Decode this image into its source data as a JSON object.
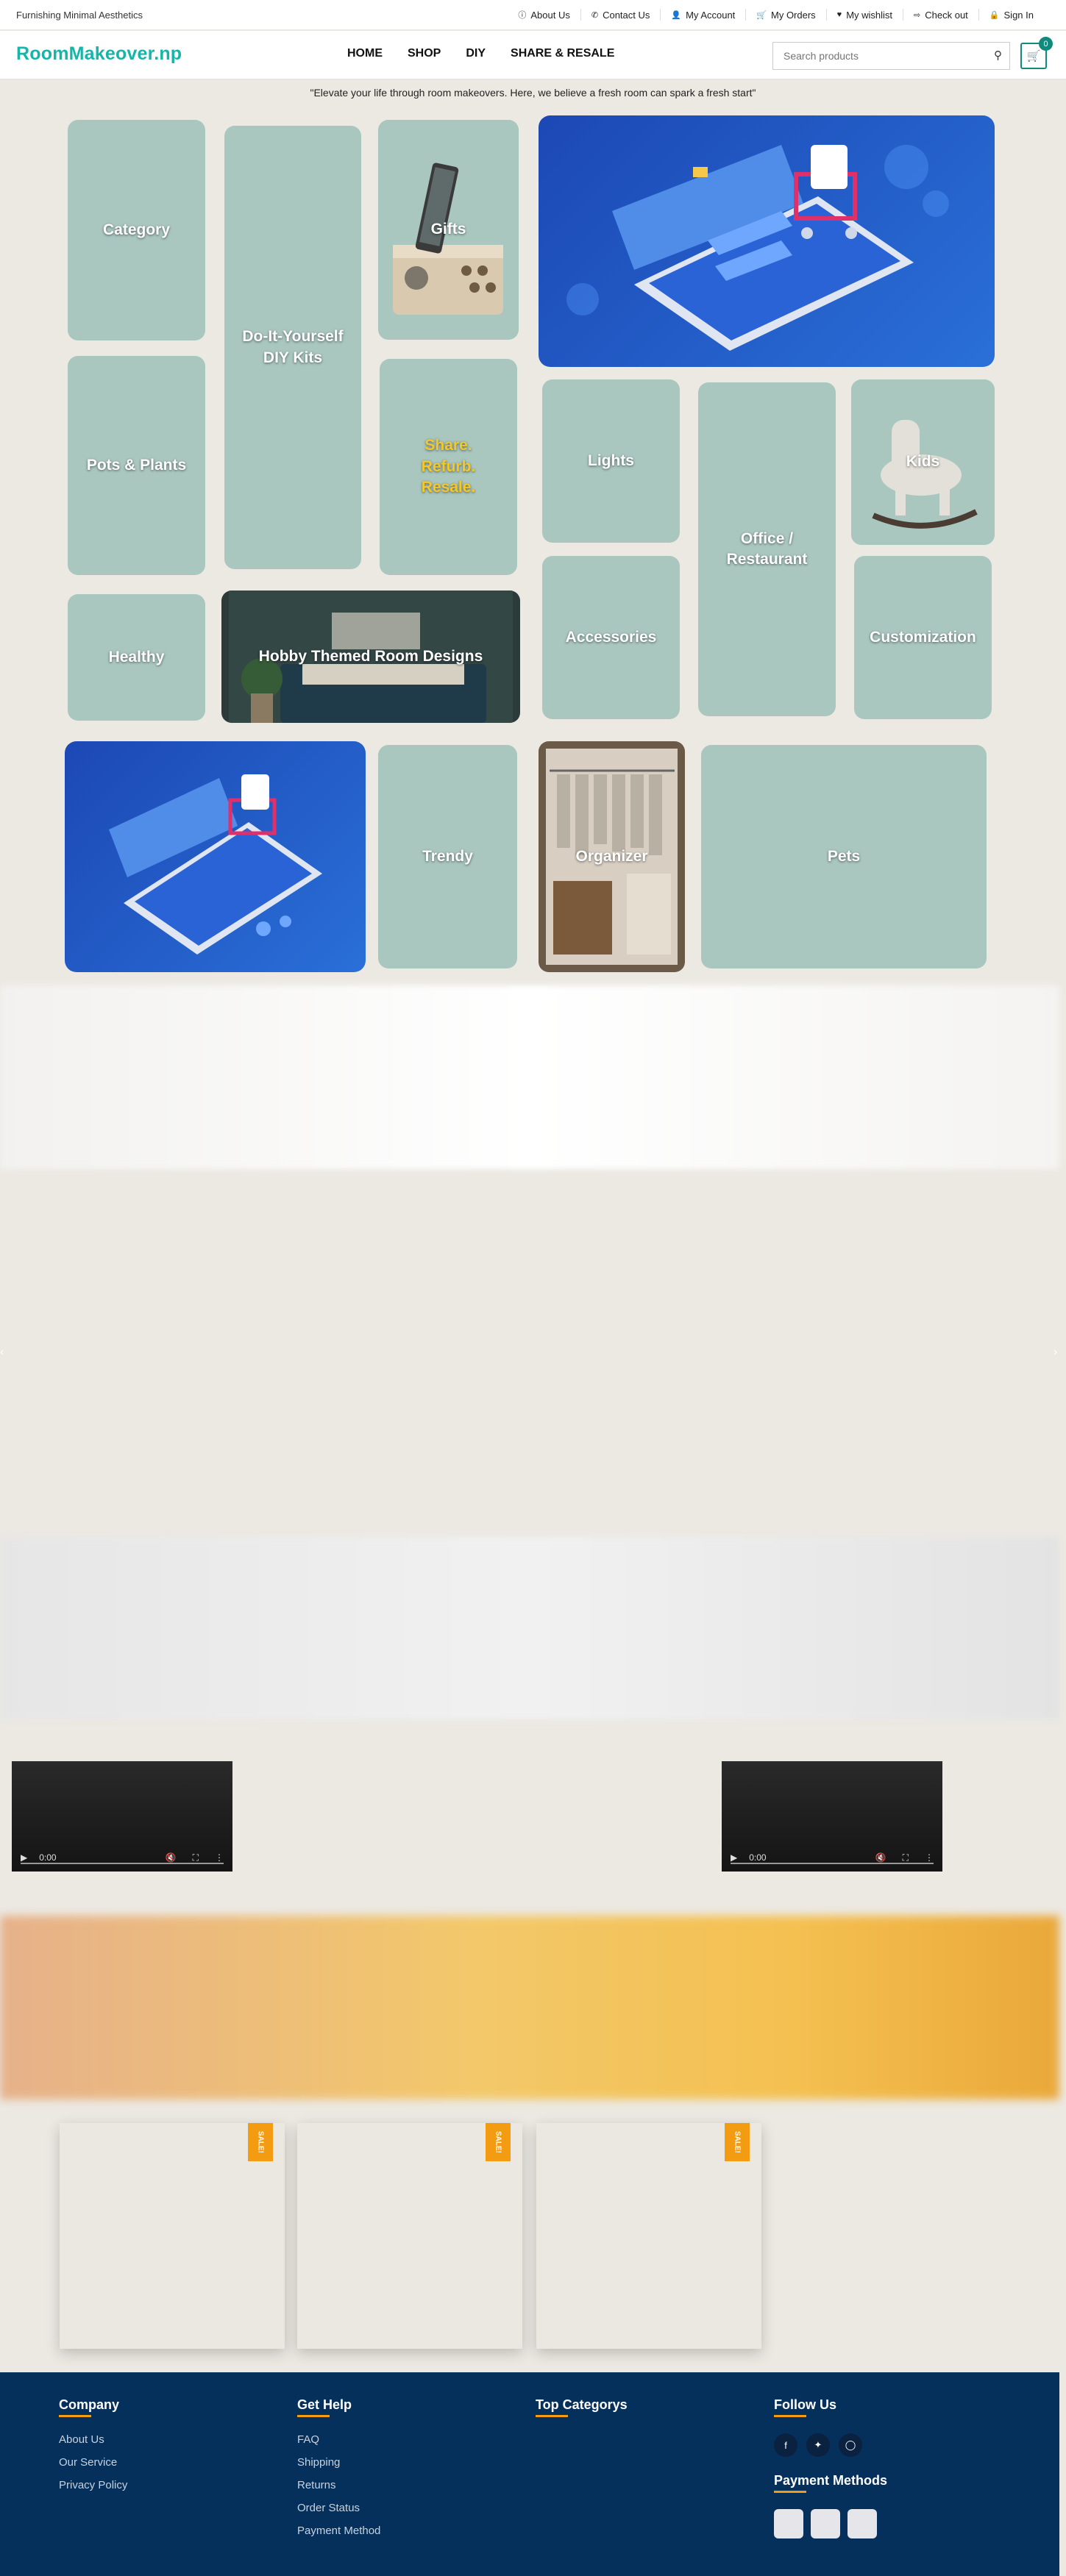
{
  "topbar": {
    "tagline": "Furnishing Minimal Aesthetics",
    "links": [
      {
        "label": "About Us",
        "icon": "info-icon",
        "glyph": "ⓘ"
      },
      {
        "label": "Contact Us",
        "icon": "phone-icon",
        "glyph": "✆"
      },
      {
        "label": "My Account",
        "icon": "user-icon",
        "glyph": "👤"
      },
      {
        "label": "My Orders",
        "icon": "cart-icon",
        "glyph": "🛒"
      },
      {
        "label": "My wishlist",
        "icon": "heart-icon",
        "glyph": "♥"
      },
      {
        "label": "Check out",
        "icon": "checkout-icon",
        "glyph": "⇨"
      },
      {
        "label": "Sign In",
        "icon": "lock-icon",
        "glyph": "🔒"
      }
    ]
  },
  "header": {
    "logo": "RoomMakeover.np",
    "nav": [
      "HOME",
      "SHOP",
      "DIY",
      "SHARE & RESALE"
    ],
    "search_placeholder": "Search products",
    "cart_count": "0"
  },
  "quote": "\"Elevate your life through room makeovers. Here, we believe a fresh room can spark a fresh start\"",
  "categories": {
    "category": "Category",
    "diy": "Do-It-Yourself DIY Kits",
    "gifts": "Gifts",
    "pots": "Pots & Plants",
    "share": "Share. Refurb. Resale.",
    "lights": "Lights",
    "office": "Office / Restaurant",
    "kids": "Kids",
    "healthy": "Healthy",
    "hobby": "Hobby Themed Room Designs",
    "accessories": "Accessories",
    "customization": "Customization",
    "trendy": "Trendy",
    "organizer": "Organizer",
    "pets": "Pets"
  },
  "videos": [
    {
      "time": "0:00"
    },
    {
      "time": "0:00"
    }
  ],
  "products": [
    {
      "badge": "SALE!"
    },
    {
      "badge": "SALE!"
    },
    {
      "badge": "SALE!"
    }
  ],
  "footer": {
    "company": {
      "title": "Company",
      "links": [
        "About Us",
        "Our Service",
        "Privacy Policy"
      ]
    },
    "help": {
      "title": "Get Help",
      "links": [
        "FAQ",
        "Shipping",
        "Returns",
        "Order Status",
        "Payment Method"
      ]
    },
    "top": {
      "title": "Top Categorys"
    },
    "follow": {
      "title": "Follow Us",
      "payment_title": "Payment Methods"
    }
  },
  "colors": {
    "brand": "#17b5a8",
    "accent": "#f39c12",
    "tile": "#a9c6bf",
    "footer": "#05305c"
  }
}
